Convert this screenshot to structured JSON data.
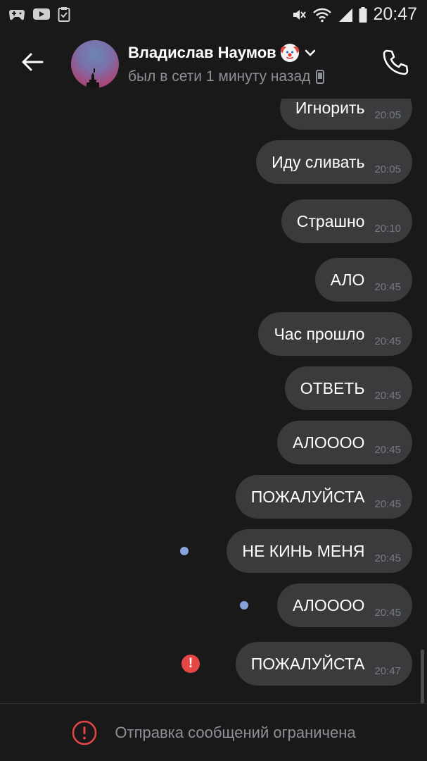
{
  "status_bar": {
    "time": "20:47",
    "left_icons": [
      "gamepad-icon",
      "youtube-icon",
      "clipboard-check-icon"
    ],
    "right_icons": [
      "mute-icon",
      "wifi-icon",
      "signal-icon",
      "battery-icon"
    ]
  },
  "header": {
    "contact_name": "Владислав Наумов",
    "status": "был в сети 1 минуту назад",
    "icons": [
      "back-arrow-icon",
      "clown-emoji-icon",
      "chevron-down-icon",
      "mobile-device-icon",
      "phone-call-icon"
    ]
  },
  "messages": [
    {
      "text": "Игнорить",
      "time": "20:05",
      "marker": ""
    },
    {
      "text": "Иду сливать",
      "time": "20:05",
      "marker": ""
    },
    {
      "text": "Страшно",
      "time": "20:10",
      "marker": ""
    },
    {
      "text": "АЛО",
      "time": "20:45",
      "marker": ""
    },
    {
      "text": "Час прошло",
      "time": "20:45",
      "marker": ""
    },
    {
      "text": "ОТВЕТЬ",
      "time": "20:45",
      "marker": ""
    },
    {
      "text": "АЛОООО",
      "time": "20:45",
      "marker": ""
    },
    {
      "text": "ПОЖАЛУЙСТА",
      "time": "20:45",
      "marker": ""
    },
    {
      "text": "НЕ КИНЬ МЕНЯ",
      "time": "20:45",
      "marker": "unread"
    },
    {
      "text": "АЛОООО",
      "time": "20:45",
      "marker": "unread"
    },
    {
      "text": "ПОЖАЛУЙСТА",
      "time": "20:47",
      "marker": "error"
    }
  ],
  "footer": {
    "restriction_text": "Отправка сообщений ограничена"
  },
  "colors": {
    "background": "#19191a",
    "bubble": "#3a3b3d",
    "unread_dot": "#86a4d8",
    "error": "#e64646",
    "muted_text": "#8d9197"
  }
}
